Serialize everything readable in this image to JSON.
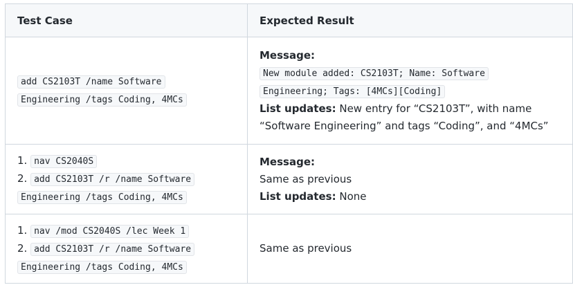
{
  "table": {
    "headers": {
      "test_case": "Test Case",
      "expected_result": "Expected Result"
    },
    "rows": [
      {
        "test_case": {
          "cmd_line1": "add CS2103T /name Software",
          "cmd_line2": "Engineering /tags Coding, 4MCs"
        },
        "expected": {
          "message_label": "Message:",
          "code_line1": "New module added: CS2103T; Name: Software",
          "code_line2": "Engineering; Tags: [4MCs][Coding]",
          "list_label": "List updates:",
          "list_line1": "New entry for “CS2103T”, with name",
          "list_line2": "“Software Engineering” and tags “Coding”, and “4MCs”"
        }
      },
      {
        "test_case": {
          "num1": "1.",
          "step1": "nav CS2040S",
          "num2": "2.",
          "step2_line1": "add CS2103T /r /name Software",
          "step2_line2": "Engineering /tags Coding, 4MCs"
        },
        "expected": {
          "message_label": "Message:",
          "message_text": "Same as previous",
          "list_label": "List updates:",
          "list_text": "None"
        }
      },
      {
        "test_case": {
          "num1": "1.",
          "step1": "nav /mod CS2040S /lec Week 1",
          "num2": "2.",
          "step2_line1": "add CS2103T /r /name Software",
          "step2_line2": "Engineering /tags Coding, 4MCs"
        },
        "expected": {
          "text": "Same as previous"
        }
      }
    ]
  }
}
